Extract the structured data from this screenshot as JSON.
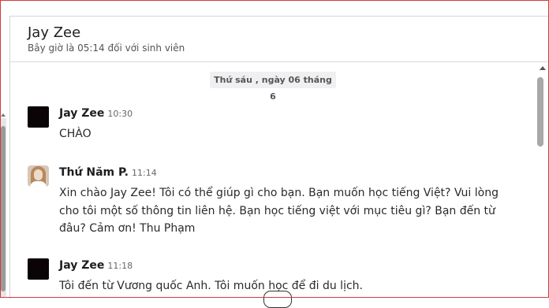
{
  "chat": {
    "contact_name": "Jay Zee",
    "status_line": "Bây giờ là 05:14 đối với sinh viên",
    "date_separator": "Thứ sáu , ngày 06 tháng 6"
  },
  "messages": [
    {
      "author": "Jay Zee",
      "time": "10:30",
      "text": "CHÀO",
      "avatar": "black-square-avatar"
    },
    {
      "author": "Thứ Năm P.",
      "time": "11:14",
      "text": "Xin chào Jay Zee! Tôi có thể giúp gì cho bạn. Bạn muốn học tiếng Việt? Vui lòng cho tôi một số thông tin liên hệ. Bạn học tiếng việt với mục tiêu gì? Bạn đến từ đâu? Cảm ơn! Thu Phạm",
      "avatar": "photo-avatar"
    },
    {
      "author": "Jay Zee",
      "time": "11:18",
      "text": "Tôi đến từ Vương quốc Anh. Tôi muốn học để đi du lịch.",
      "avatar": "black-square-avatar"
    }
  ],
  "colors": {
    "frame_border": "#d23b3b",
    "date_chip_bg": "#f0f0f3",
    "avatar_dark": "#0a0406"
  }
}
